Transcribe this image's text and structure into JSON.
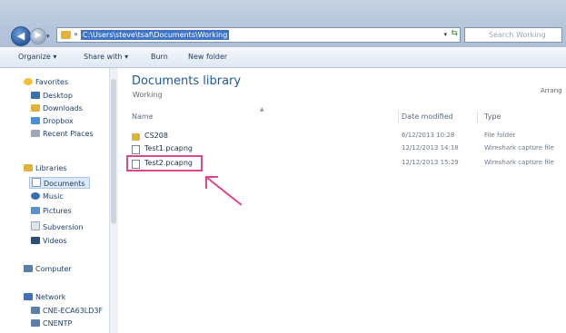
{
  "address": {
    "path": "C:\\Users\\steve\\tsaf\\Documents\\Working",
    "search_placeholder": "Search Working"
  },
  "toolbar": {
    "organize": "Organize ▾",
    "share_with": "Share with ▾",
    "burn": "Burn",
    "new_folder": "New folder"
  },
  "sidebar": {
    "favorites": "Favorites",
    "desktop": "Desktop",
    "downloads": "Downloads",
    "dropbox": "Dropbox",
    "recent_places": "Recent Places",
    "libraries": "Libraries",
    "documents": "Documents",
    "music": "Music",
    "pictures": "Pictures",
    "subversion": "Subversion",
    "videos": "Videos",
    "computer": "Computer",
    "network": "Network",
    "net1": "CNE-ECA63LD3F",
    "net2": "CNENTP"
  },
  "library": {
    "title": "Documents library",
    "subtitle": "Working",
    "arrange": "Arrang"
  },
  "columns": {
    "name": "Name",
    "date_modified": "Date modified",
    "type": "Type"
  },
  "files": [
    {
      "name": "CS208",
      "date": "6/12/2013 10:28",
      "type": "File folder",
      "icon": "folder-icon"
    },
    {
      "name": "Test1.pcapng",
      "date": "12/12/2013 14:18",
      "type": "Wireshark capture file",
      "icon": "document-icon"
    },
    {
      "name": "Test2.pcapng",
      "date": "12/12/2013 15:29",
      "type": "Wireshark capture file",
      "icon": "document-icon"
    }
  ],
  "colors": {
    "highlight": "#e0468d",
    "selection": "#3e74c8"
  }
}
